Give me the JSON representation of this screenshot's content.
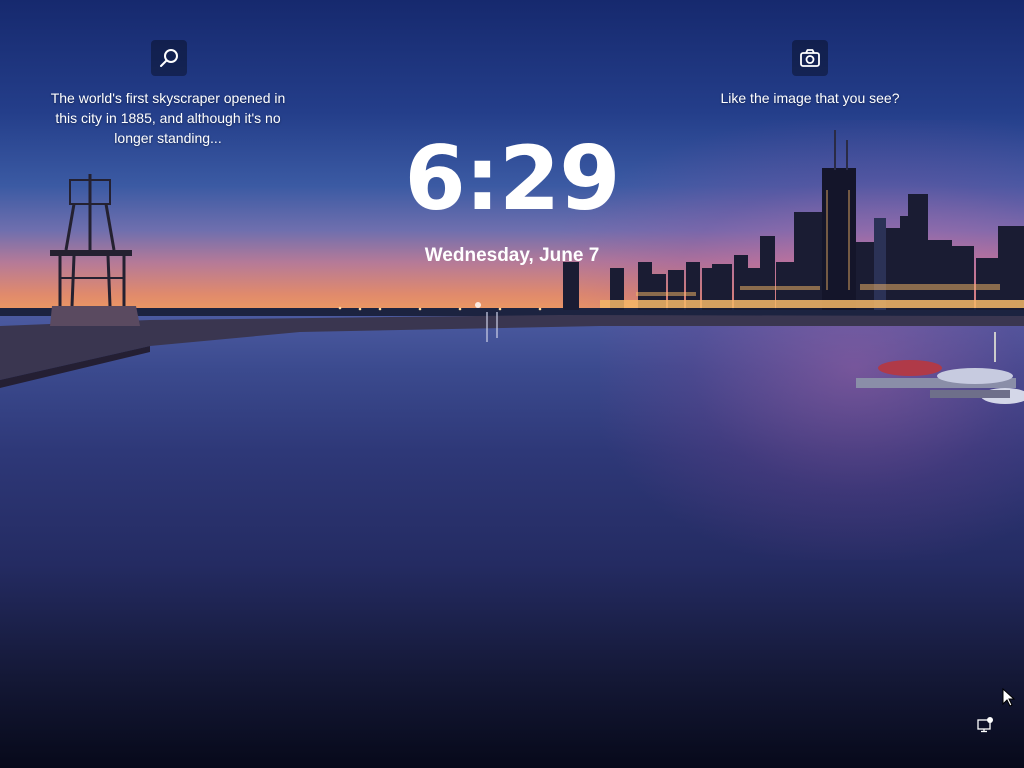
{
  "lockscreen": {
    "time": "6:29",
    "date": "Wednesday, June 7",
    "spotlight_fact": "The world's first skyscraper opened in this city in 1885, and although it's no longer standing...",
    "spotlight_like_prompt": "Like the image that you see?"
  },
  "icons": {
    "facts": "magnifier-icon",
    "like": "camera-icon",
    "status": "network-status-icon",
    "pointer": "mouse-pointer-icon"
  },
  "colors": {
    "sky_top": "#16296e",
    "horizon": "#f3a05c",
    "water_dark": "#07091a",
    "text": "#ffffff"
  }
}
